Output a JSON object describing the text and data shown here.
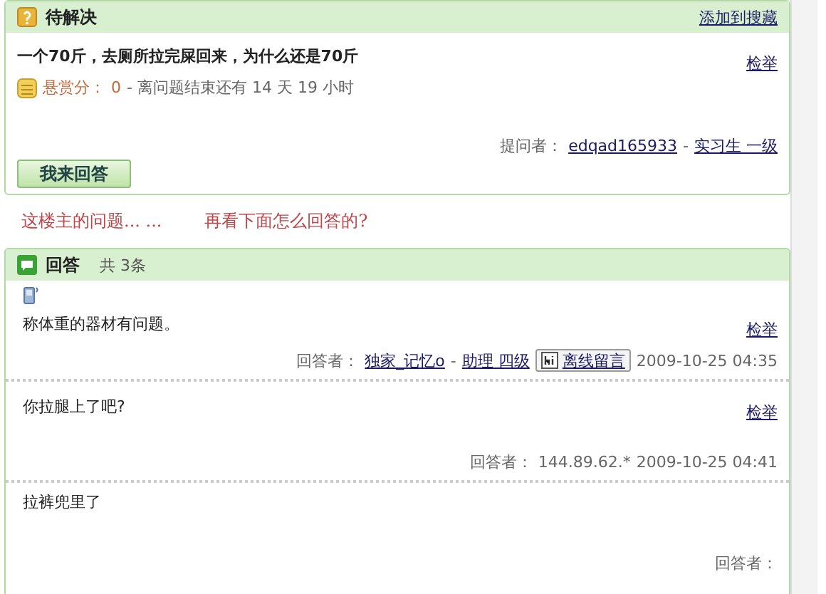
{
  "question_panel": {
    "title": "待解决",
    "favorite_link": "添加到搜藏",
    "question": "一个70斤，去厕所拉完屎回来，为什么还是70斤",
    "reward_label": "悬赏分：",
    "reward_value": "0",
    "time_left": "- 离问题结束还有  14 天  19 小时",
    "report_link": "检举",
    "asker_label": "提问者：",
    "asker_name": "edqad165933",
    "separator": "-",
    "asker_rank": "实习生 一级",
    "answer_button": "我来回答"
  },
  "caption": {
    "left": "这楼主的问题... ...",
    "right": "再看下面怎么回答的?"
  },
  "answers_panel": {
    "title": "回答",
    "count": "共 3条",
    "answers": [
      {
        "mobile": true,
        "text": "称体重的器材有问题。",
        "report_link": "检举",
        "responder_label": "回答者：",
        "responder_name": "独家_记忆o",
        "separator": "-",
        "rank": "助理 四级",
        "message_button": "离线留言",
        "time": "2009-10-25 04:35"
      },
      {
        "mobile": false,
        "text": "你拉腿上了吧?",
        "report_link": "检举",
        "responder_label": "回答者：",
        "responder_name": "144.89.62.*",
        "time": "2009-10-25 04:41"
      },
      {
        "mobile": false,
        "text": "拉裤兜里了",
        "responder_label": "回答者："
      }
    ]
  }
}
